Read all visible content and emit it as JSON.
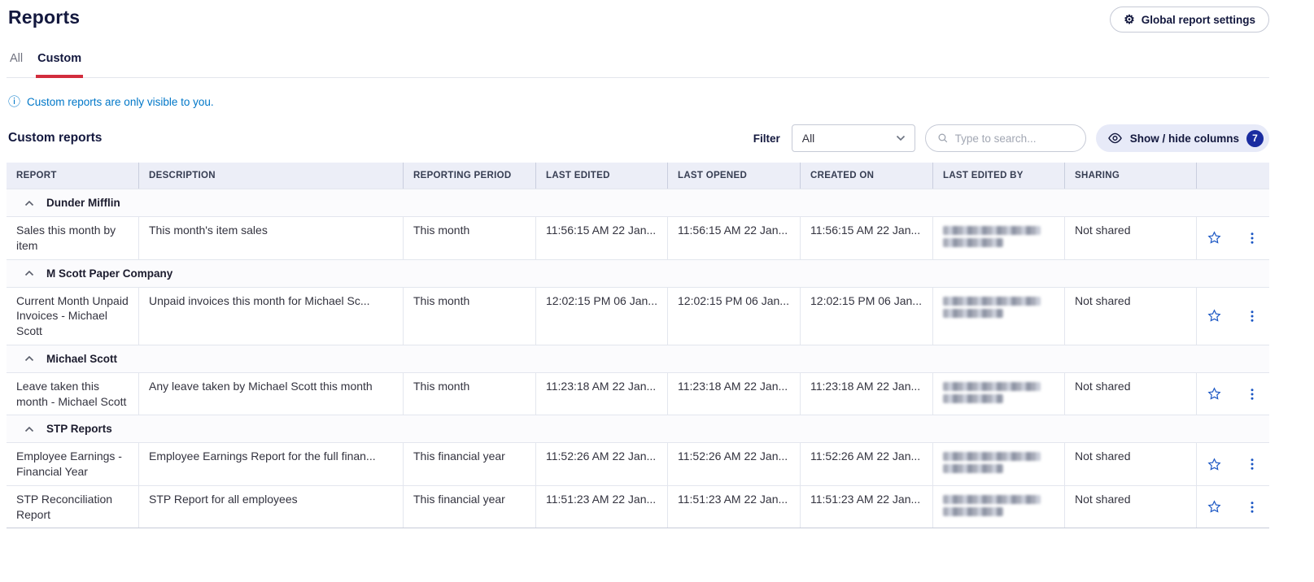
{
  "page": {
    "title": "Reports",
    "settings_button_label": "Global report settings"
  },
  "tabs": {
    "all": "All",
    "custom": "Custom"
  },
  "info_banner": {
    "text": "Custom reports are only visible to you."
  },
  "toolbar": {
    "section_title": "Custom reports",
    "filter_label": "Filter",
    "filter_value": "All",
    "search_placeholder": "Type to search...",
    "show_hide_columns_label": "Show / hide columns",
    "columns_badge": "7"
  },
  "table": {
    "headers": [
      "REPORT",
      "DESCRIPTION",
      "REPORTING PERIOD",
      "LAST EDITED",
      "LAST OPENED",
      "CREATED ON",
      "LAST EDITED BY",
      "SHARING"
    ],
    "groups": [
      {
        "name": "Dunder Mifflin",
        "rows": [
          {
            "report": "Sales this month by item",
            "description": "This month's item sales",
            "reporting_period": "This month",
            "last_edited": "11:56:15 AM 22 Jan...",
            "last_opened": "11:56:15 AM 22 Jan...",
            "created_on": "11:56:15 AM 22 Jan...",
            "sharing": "Not shared"
          }
        ]
      },
      {
        "name": "M Scott Paper Company",
        "rows": [
          {
            "report": "Current Month Unpaid Invoices - Michael Scott",
            "description": "Unpaid invoices this month for Michael Sc...",
            "reporting_period": "This month",
            "last_edited": "12:02:15 PM 06 Jan...",
            "last_opened": "12:02:15 PM 06 Jan...",
            "created_on": "12:02:15 PM 06 Jan...",
            "sharing": "Not shared"
          }
        ]
      },
      {
        "name": "Michael Scott",
        "rows": [
          {
            "report": "Leave taken this month - Michael Scott",
            "description": "Any leave taken by Michael Scott this month",
            "reporting_period": "This month",
            "last_edited": "11:23:18 AM 22 Jan...",
            "last_opened": "11:23:18 AM 22 Jan...",
            "created_on": "11:23:18 AM 22 Jan...",
            "sharing": "Not shared"
          }
        ]
      },
      {
        "name": "STP Reports",
        "rows": [
          {
            "report": "Employee Earnings - Financial Year",
            "description": "Employee Earnings Report for the full finan...",
            "reporting_period": "This financial year",
            "last_edited": "11:52:26 AM 22 Jan...",
            "last_opened": "11:52:26 AM 22 Jan...",
            "created_on": "11:52:26 AM 22 Jan...",
            "sharing": "Not shared"
          },
          {
            "report": "STP Reconciliation Report",
            "description": "STP Report for all employees",
            "reporting_period": "This financial year",
            "last_edited": "11:51:23 AM 22 Jan...",
            "last_opened": "11:51:23 AM 22 Jan...",
            "created_on": "11:51:23 AM 22 Jan...",
            "sharing": "Not shared"
          }
        ]
      }
    ]
  },
  "colors": {
    "accent_navy": "#13183E",
    "tab_underline_red": "#D22D3D",
    "info_link_blue": "#0077C8",
    "row_icon_blue": "#1A56C4",
    "badge_navy": "#1A2CA0",
    "table_header_bg": "#ECEEF7"
  }
}
